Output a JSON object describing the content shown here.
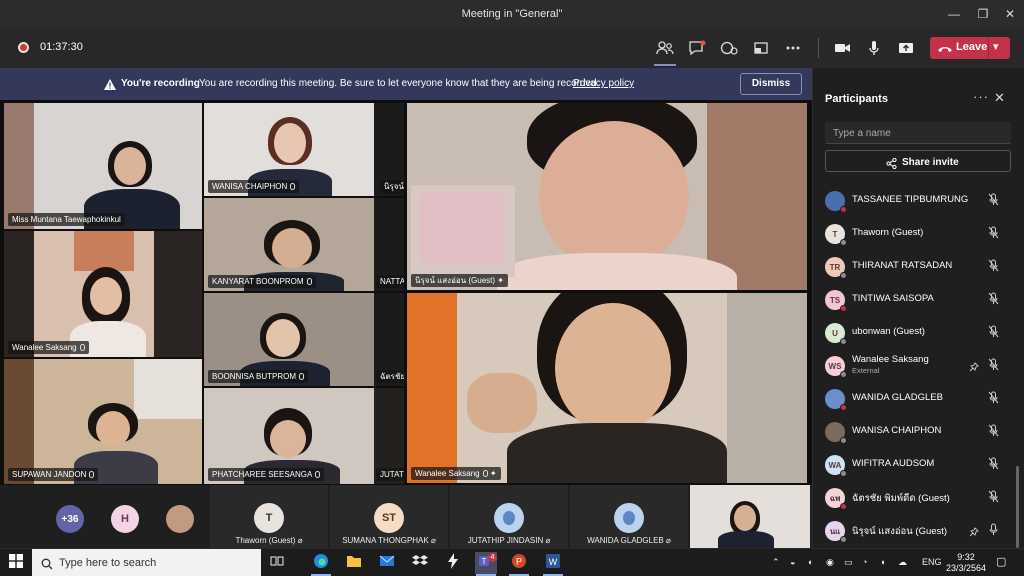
{
  "window": {
    "title": "Meeting in \"General\"",
    "minimize": "—",
    "maximize": "❐",
    "close": "✕"
  },
  "toolbar": {
    "timer": "01:37:30",
    "leave_label": "Leave",
    "leave_caret": "▾"
  },
  "banner": {
    "title": "You're recording",
    "message": "You are recording this meeting. Be sure to let everyone know that they are being recorded.",
    "link": "Privacy policy",
    "dismiss": "Dismiss"
  },
  "grid_tiles": [
    {
      "name": "Miss Muntana Taewaphokinkul"
    },
    {
      "name": "WANISA CHAIPHON"
    },
    {
      "name": "นิรุจน์"
    },
    {
      "name": "KANYARAT BOONPROM"
    },
    {
      "name": "NATTA"
    },
    {
      "name": "Wanalee Saksang"
    },
    {
      "name": "BOONNISA BUTPROM"
    },
    {
      "name": "ฉัตรชัย"
    },
    {
      "name": "SUPAWAN JANDON"
    },
    {
      "name": "PHATCHAREE SEESANGA"
    },
    {
      "name": "JUTAT"
    }
  ],
  "main_tiles": [
    {
      "name": "นิรุจน์ แสงอ่อน (Guest)"
    },
    {
      "name": "Wanalee Saksang"
    }
  ],
  "strip": {
    "overflow": "+36",
    "h_initial": "H",
    "tiles": [
      {
        "initials": "T",
        "name": "Thaworn (Guest)"
      },
      {
        "initials": "ST",
        "name": "SUMANA THONGPHAK"
      },
      {
        "initials": "",
        "name": "JUTATHIP JINDASIN"
      },
      {
        "initials": "",
        "name": "WANIDA GLADGLEB"
      }
    ]
  },
  "participants": {
    "title": "Participants",
    "more": "···",
    "close": "✕",
    "search_placeholder": "Type a name",
    "share_invite": "Share invite",
    "list": [
      {
        "initials": "",
        "name": "TASSANEE TIPBUMRUNG",
        "sub": "",
        "color": "#4a6fb0"
      },
      {
        "initials": "T",
        "name": "Thaworn (Guest)",
        "sub": "",
        "color": "#e8e3dc"
      },
      {
        "initials": "TR",
        "name": "THIRANAT RATSADAN",
        "sub": "",
        "color": "#f1c9b8"
      },
      {
        "initials": "TS",
        "name": "TINTIWA SAISOPA",
        "sub": "",
        "color": "#f4c6d4"
      },
      {
        "initials": "U",
        "name": "ubonwan (Guest)",
        "sub": "",
        "color": "#d9ead3"
      },
      {
        "initials": "WS",
        "name": "Wanalee Saksang",
        "sub": "External",
        "color": "#f6cfd6"
      },
      {
        "initials": "",
        "name": "WANIDA GLADGLEB",
        "sub": "",
        "color": "#6d8fc9"
      },
      {
        "initials": "",
        "name": "WANISA CHAIPHON",
        "sub": "",
        "color": "#7a6b5c"
      },
      {
        "initials": "WA",
        "name": "WIFITRA AUDSOM",
        "sub": "",
        "color": "#cfe3f5"
      },
      {
        "initials": "ฉพ",
        "name": "ฉัตรชัย พิมพ์ดีด (Guest)",
        "sub": "",
        "color": "#f4d3d6"
      },
      {
        "initials": "นแ",
        "name": "นิรุจน์ แสงอ่อน (Guest)",
        "sub": "",
        "color": "#e7d4f0"
      }
    ]
  },
  "taskbar": {
    "search_text": "Type here to search",
    "teams_badge": "4",
    "lang": "ENG",
    "time": "9:32",
    "date": "23/3/2564"
  },
  "colors": {
    "accent": "#6264a7",
    "leave": "#c4314b",
    "banner": "#34395c"
  }
}
